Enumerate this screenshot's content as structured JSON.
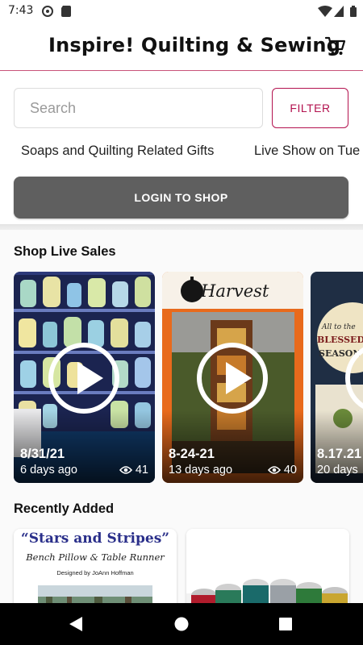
{
  "status_bar": {
    "time": "7:43"
  },
  "header": {
    "title": "Inspire! Quilting & Sewing"
  },
  "search": {
    "placeholder": "Search",
    "filter_label": "FILTER"
  },
  "categories": [
    "Soaps and Quilting Related Gifts",
    "Live Show on Tue"
  ],
  "login": {
    "label": "LOGIN TO SHOP"
  },
  "live_sales": {
    "title": "Shop Live Sales",
    "cards": [
      {
        "date": "8/31/21",
        "ago": "6 days ago",
        "views": "41"
      },
      {
        "date": "8-24-21",
        "ago": "13 days ago",
        "views": "40"
      },
      {
        "date": "8.17.21",
        "ago": "20 days",
        "views": ""
      }
    ],
    "card3_text": [
      "All to the",
      "BLESSED",
      "SEASON"
    ]
  },
  "harvest_text": "Harvest",
  "recently_added": {
    "title": "Recently Added",
    "items": [
      {
        "heading": "“Stars and Stripes”",
        "subtitle": "Bench Pillow & Table Runner",
        "credit": "Designed by JoAnn Hoffman"
      },
      {
        "heading": "",
        "subtitle": "",
        "credit": ""
      }
    ]
  },
  "colors": {
    "accent": "#b3124f",
    "header_rule": "#c8537a",
    "login_bg": "#5f5f5f"
  }
}
